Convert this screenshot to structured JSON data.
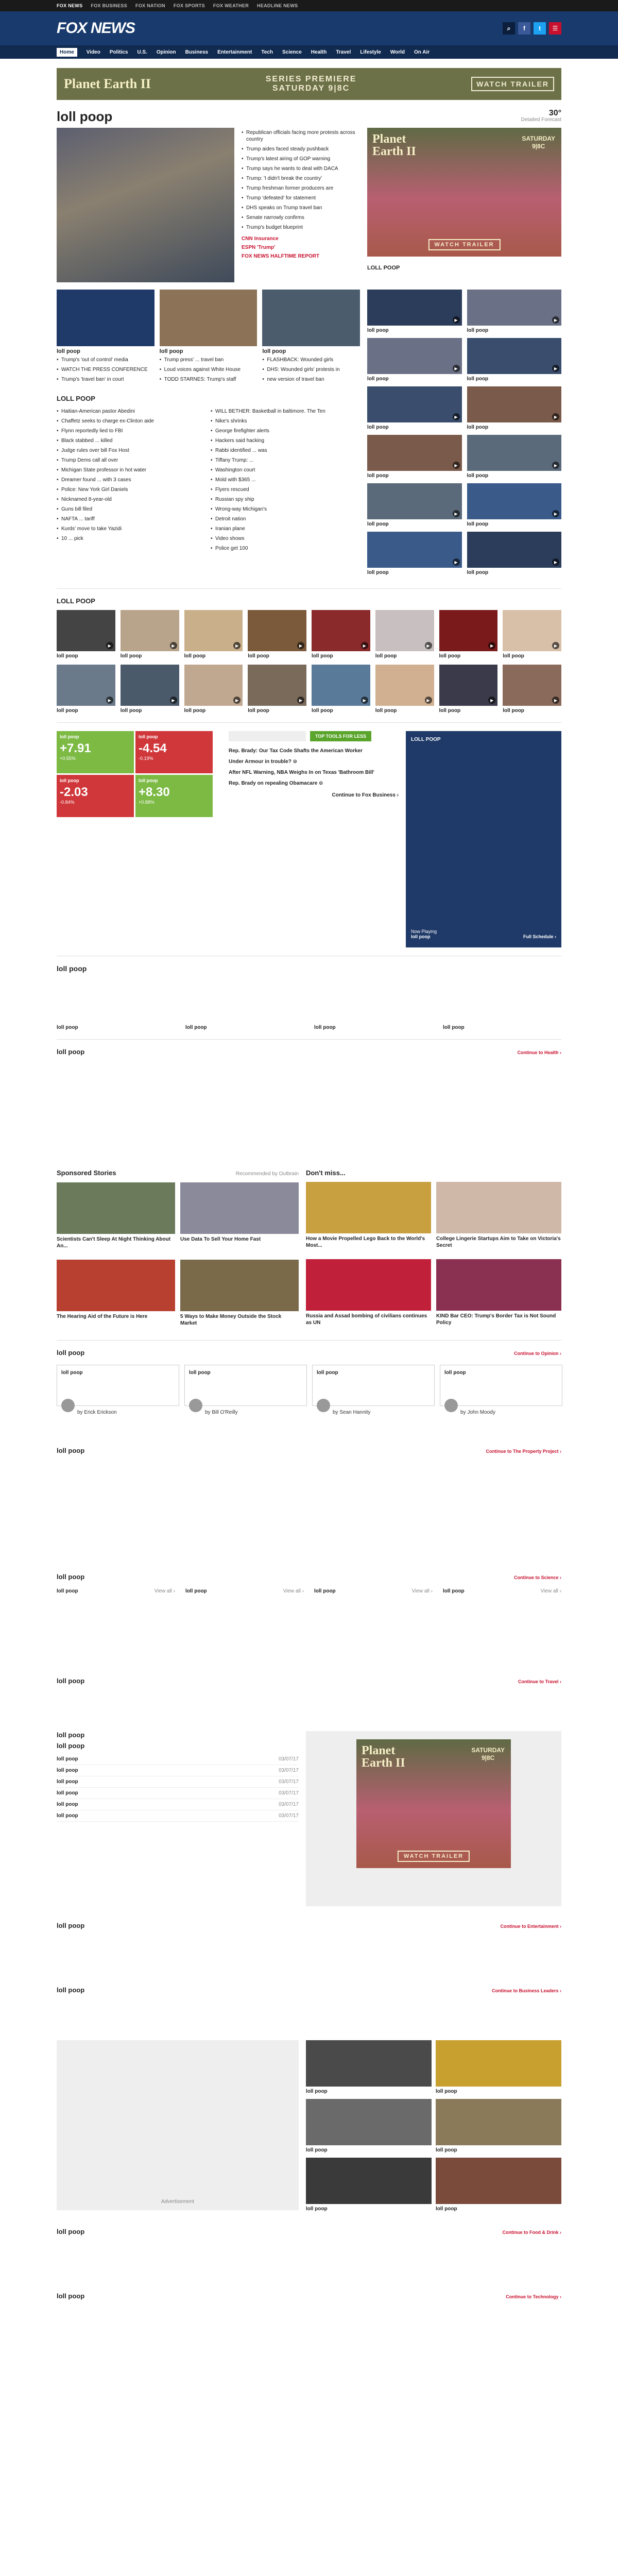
{
  "netbar": [
    "FOX NEWS",
    "FOX BUSINESS",
    "FOX NATION",
    "FOX SPORTS",
    "FOX WEATHER",
    "HEADLINE NEWS"
  ],
  "header": {
    "logo": "FOX NEWS"
  },
  "nav": [
    "Home",
    "Video",
    "Politics",
    "U.S.",
    "Opinion",
    "Business",
    "Entertainment",
    "Tech",
    "Science",
    "Health",
    "Travel",
    "Lifestyle",
    "World",
    "On Air"
  ],
  "ad": {
    "title": "Planet Earth II",
    "mid1": "SERIES PREMIERE",
    "mid2": "SATURDAY 9|8C",
    "cta": "WATCH TRAILER",
    "sat": "SATURDAY",
    "time": "9|8C"
  },
  "top": {
    "headline": "loll poop",
    "weather": "30°",
    "weather_link": "Detailed Forecast",
    "bullets": [
      "Republican officials facing more protests across country",
      "Trump aides faced steady pushback",
      "Trump's latest airing of GOP warning",
      "Trump says he wants to deal with DACA",
      "Trump: 'I didn't break the country'",
      "Trump freshman former producers are",
      "Trump 'defeated' for statement",
      "DHS speaks on Trump travel ban",
      "Senate narrowly confirms",
      "Trump's budget blueprint"
    ],
    "alerts": [
      "CNN Insurance",
      "ESPN 'Trump'",
      "FOX NEWS HALFTIME REPORT"
    ],
    "subs": [
      {
        "title": "loll poop",
        "items": [
          "Trump's 'out of control' media",
          "WATCH THE PRESS CONFERENCE",
          "Trump's 'travel ban' in court"
        ]
      },
      {
        "title": "loll poop",
        "items": [
          "Trump press' ... travel ban",
          "Loud voices against White House",
          "TODD STARNES: Trump's staff"
        ]
      },
      {
        "title": "loll poop",
        "items": [
          "FLASHBACK: Wounded girls",
          "DHS: Wounded girls' protests in",
          "new version of travel ban"
        ]
      }
    ]
  },
  "loll_label": "LOLL POOP",
  "left_list": [
    "Haitian-American pastor Abedini",
    "Chaffetz seeks to charge ex-Clinton aide",
    "Flynn reportedly lied to FBI",
    "Black stabbed ... killed",
    "Judge rules over bill Fox Host",
    "Trump Dems call all over",
    "Michigan State professor in hot water",
    "Dreamer found ... with 3 cases",
    "Police: New York Girl Daniels",
    "Nicknamed 8-year-old",
    "Guns bill filed",
    "NAFTA ... tariff",
    "Kurds' move to take Yazidi",
    "10 ... pick"
  ],
  "mid_list": [
    "WILL BETHER: Basketball in baltimore. The Ten",
    "Nike's shrinks",
    "George firefighter alerts",
    "Hackers said hacking",
    "Rabbi identified ... was",
    "Tiffany Trump: ...",
    "Washington court",
    "Mold with $365 ...",
    "Flyers rescued",
    "Russian spy ship",
    "Wrong-way Michigan's",
    "Detroit nation",
    "Iranian plane",
    "Video shows",
    "Police get 100"
  ],
  "side_videos": [
    [
      "loll poop",
      "loll poop"
    ],
    [
      "loll poop",
      "loll poop"
    ],
    [
      "loll poop",
      "loll poop"
    ],
    [
      "loll poop",
      "loll poop"
    ],
    [
      "loll poop",
      "loll poop"
    ],
    [
      "loll poop",
      "loll poop"
    ]
  ],
  "grid_labels": [
    "loll poop",
    "loll poop",
    "loll poop",
    "loll poop",
    "loll poop",
    "loll poop",
    "loll poop",
    "loll poop"
  ],
  "stocks": [
    {
      "name": "loll poop",
      "val": "+7.91",
      "pct": "+0.55%",
      "color": "grn"
    },
    {
      "name": "loll poop",
      "val": "-4.54",
      "pct": "-0.19%",
      "color": "rd"
    },
    {
      "name": "loll poop",
      "val": "-2.03",
      "pct": "-0.84%",
      "color": "rd"
    },
    {
      "name": "loll poop",
      "val": "+8.30",
      "pct": "+0.88%",
      "color": "grn"
    }
  ],
  "business": {
    "top_tools": "TOP TOOLS FOR LESS",
    "links": [
      "Rep. Brady: Our Tax Code Shafts the American Worker",
      "Under Armour in trouble? ⊙",
      "After NFL Warning, NBA Weighs In on Texas 'Bathroom Bill'",
      "Rep. Brady on repealing Obamacare ⊙"
    ],
    "continue": "Continue to Fox Business ›"
  },
  "live": {
    "title": "LOLL POOP",
    "now": "Now Playing",
    "np": "loll poop",
    "sched": "Full Schedule ›"
  },
  "sections": [
    "loll poop",
    "loll poop",
    "loll poop",
    "loll poop",
    "loll poop",
    "loll poop",
    "loll poop",
    "loll poop",
    "loll poop",
    "loll poop",
    "loll poop",
    "loll poop"
  ],
  "continue": {
    "health": "Continue to Health ›",
    "opinion": "Continue to Opinion ›",
    "property": "Continue to The Property Project ›",
    "science": "Continue to Science ›",
    "travel": "Continue to Travel ›",
    "ent": "Continue to Entertainment ›",
    "leaders": "Continue to Business Leaders ›",
    "food": "Continue to Food & Drink ›",
    "tech": "Continue to Technology ›"
  },
  "sponsored": {
    "title": "Sponsored Stories",
    "by": "Recommended by Outbrain",
    "dont": "Don't miss...",
    "items": [
      "Scientists Can't Sleep At Night Thinking About An...",
      "Use Data To Sell Your Home Fast",
      "How a Movie Propelled Lego Back to the World's Most...",
      "College Lingerie Startups Aim to Take on Victoria's Secret",
      "The Hearing Aid of the Future is Here",
      "5 Ways to Make Money Outside the Stock Market",
      "Russia and Assad bombing of civilians continues as UN",
      "KIND Bar CEO: Trump's Border Tax is Not Sound Policy"
    ]
  },
  "opinion": [
    {
      "t": "loll poop",
      "a": "by Erick Erickson"
    },
    {
      "t": "loll poop",
      "a": "by Bill O'Reilly"
    },
    {
      "t": "loll poop",
      "a": "by Sean Hannity"
    },
    {
      "t": "loll poop",
      "a": "by John Moody"
    }
  ],
  "view_all": "View all ›",
  "dates": [
    "03/07/17",
    "03/07/17",
    "03/07/17",
    "03/07/17",
    "03/07/17",
    "03/07/17"
  ],
  "advert": "Advertisement"
}
